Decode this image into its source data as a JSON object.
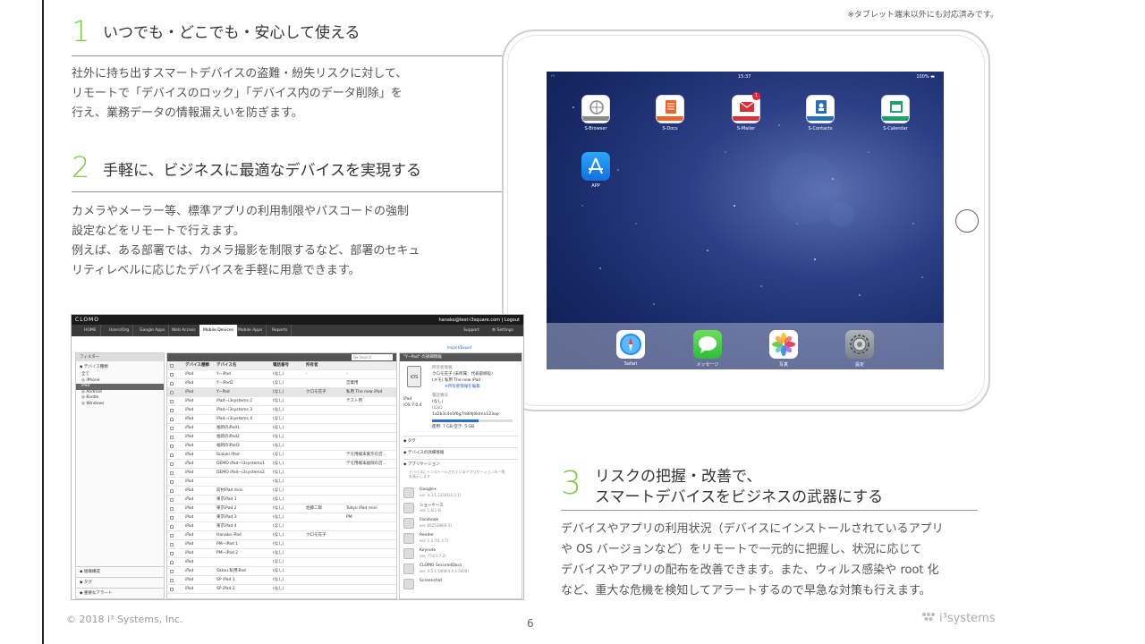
{
  "note": "※タブレット端末以外にも対応済みです。",
  "sections": [
    {
      "number": "1",
      "title": "いつでも・どこでも・安心して使える",
      "body": [
        "社外に持ち出すスマートデバイスの盗難・紛失リスクに対して、",
        "リモートで「デバイスのロック」「デバイス内のデータ削除」を",
        "行え、業務データの情報漏えいを防ぎます。"
      ]
    },
    {
      "number": "2",
      "title": "手軽に、ビジネスに最適なデバイスを実現する",
      "body": [
        "カメラやメーラー等、標準アプリの利用制限やパスコードの強制",
        "設定などをリモートで行えます。",
        "例えば、ある部署では、カメラ撮影を制限するなど、部署のセキュ",
        "リティレベルに応じたデバイスを手軽に用意できます。"
      ]
    },
    {
      "number": "3",
      "title_line1": "リスクの把握・改善で、",
      "title_line2": "スマートデバイスをビジネスの武器にする",
      "body": [
        "デバイスやアプリの利用状況（デバイスにインストールされているアプリ",
        "や OS バージョンなど）をリモートで一元的に把握し、状況に応じて",
        "デバイスやアプリの配布を改善できます。また、ウィルス感染や root 化",
        "など、重大な危機を検知してアラートするので早急な対策も行えます。"
      ]
    }
  ],
  "ipad": {
    "time": "15:37",
    "battery": "100%",
    "apps": [
      {
        "label": "S-Browser",
        "icon": "globe-icon",
        "color": "#8a8a8a",
        "band": "CLOMO"
      },
      {
        "label": "S-Docs",
        "icon": "document-icon",
        "color": "#e8662a",
        "band": "CLOMO"
      },
      {
        "label": "S-Mailer",
        "icon": "mail-icon",
        "color": "#d8303a",
        "band": "CLOMO",
        "badge": "1"
      },
      {
        "label": "S-Contacts",
        "icon": "contacts-icon",
        "color": "#2a6fb4",
        "band": "CLOMO"
      },
      {
        "label": "S-Calendar",
        "icon": "calendar-icon",
        "color": "#20a070",
        "band": "CLOMO"
      },
      {
        "label": "APP",
        "icon": "app-store-icon",
        "color": "#1e8ef0"
      }
    ],
    "dock": [
      {
        "label": "Safari",
        "icon": "safari-icon"
      },
      {
        "label": "メッセージ",
        "icon": "messages-icon"
      },
      {
        "label": "写真",
        "icon": "photos-icon"
      },
      {
        "label": "設定",
        "icon": "settings-icon"
      }
    ]
  },
  "console": {
    "logo": "CLOMO",
    "user": "hanako@test-i3square.com | Logout",
    "tabs": [
      "HOME",
      "Users/Org",
      "Google Apps",
      "Web Access",
      "Mobile Devices",
      "Mobile Apps",
      "Reports"
    ],
    "active_tab": "Mobile Devices",
    "support": "Support",
    "settings": "⚙ Settings",
    "import_export": "Import/Export",
    "filter": "フィルター",
    "device_type": "◆ デバイス種類",
    "filter_items": [
      "全て",
      "◎ iPhone",
      "iPad",
      "◎ Android",
      "◎ Kindle",
      "◎ Windows"
    ],
    "side_footer": [
      "◆ 組織構成",
      "◆ タグ",
      "◆ 重要なアラート"
    ],
    "search": "Q▾ Search",
    "columns": [
      "デバイス種類",
      "デバイス名",
      "電話番号",
      "所有者"
    ],
    "rows": [
      [
        "iPad",
        "Y−iPad",
        "(なし)",
        "-",
        "-"
      ],
      [
        "iPad",
        "Y−iPad2",
        "(なし)",
        "",
        "営業用"
      ],
      [
        "iPad",
        "Y−Pad",
        "(なし)",
        "クロモ花子",
        "私用 The new iPad"
      ],
      [
        "iPad",
        "iPad−i3systems 2",
        "(なし)",
        "",
        "テスト用"
      ],
      [
        "iPad",
        "iPad−i3systems 3",
        "(なし)",
        "",
        ""
      ],
      [
        "iPad",
        "iPad−i3systems 4",
        "(なし)",
        "",
        ""
      ],
      [
        "iPad",
        "福岡のiPad1",
        "(なし)",
        "",
        ""
      ],
      [
        "iPad",
        "福岡のiPad2",
        "(なし)",
        "",
        ""
      ],
      [
        "iPad",
        "福岡のiPad3",
        "(なし)",
        "",
        ""
      ],
      [
        "iPad",
        "Suzuki iPad",
        "(なし)",
        "",
        "デモ用端末東京の営..."
      ],
      [
        "iPad",
        "DEMO iPad−i3systems1",
        "(なし)",
        "",
        "デモ用端末福岡の営..."
      ],
      [
        "iPad",
        "DEMO iPad−i3systems2",
        "(なし)",
        "",
        ""
      ],
      [
        "iPad",
        "",
        "(なし)",
        "",
        ""
      ],
      [
        "iPad",
        "前村iPad mini",
        "(なし)",
        "",
        ""
      ],
      [
        "iPad",
        "東京iPad 1",
        "(なし)",
        "",
        ""
      ],
      [
        "iPad",
        "東京iPad 2",
        "(なし)",
        "佐藤二郎",
        "Tokyo iPad mini"
      ],
      [
        "iPad",
        "東京iPad 3",
        "(なし)",
        "",
        "PM"
      ],
      [
        "iPad",
        "東京iPad 4",
        "(なし)",
        "",
        ""
      ],
      [
        "iPad",
        "Hanako iPad",
        "(なし)",
        "クロモ花子",
        ""
      ],
      [
        "iPad",
        "PM−iPad 1",
        "(なし)",
        "",
        ""
      ],
      [
        "iPad",
        "PM−iPad 2",
        "(なし)",
        "",
        ""
      ],
      [
        "iPad",
        "",
        "(なし)",
        "",
        ""
      ],
      [
        "iPad",
        "Satou 私用iPad",
        "(なし)",
        "",
        ""
      ],
      [
        "iPad",
        "SP iPad 1",
        "(なし)",
        "",
        ""
      ],
      [
        "iPad",
        "SP iPad 2",
        "(なし)",
        "",
        ""
      ]
    ],
    "detail": {
      "header": "\"Y−Pad\" の詳細情報",
      "owner_label": "所有者情報",
      "owner": "クロモ花子 (未所属：代表取締役)",
      "usage": "(メモ)  私用 The new iPad",
      "edit": "※所有者情報を編集",
      "ios": "iOS",
      "device": "iPad",
      "os": "iOS 7.0.4",
      "phone_label": "電話番号",
      "phone": "(なし)",
      "udid_label": "UDID",
      "udid": "1a2b3c4e5f6g7h8i9j0klmn123op",
      "capacity": "使用: 7 GB   空き: 5 GB",
      "sections": [
        "◆ タグ",
        "◆ デバイスの詳細情報",
        "◆ アプリケーション"
      ],
      "apps_note": "デバイスにインストールされているアプリケーションの一覧を表示します",
      "apps": [
        {
          "name": "Google+",
          "ver": "ver. 4.3.1.23341(4.3.1)"
        },
        {
          "name": "ショーケース",
          "ver": "ver. 1.6(1.6)"
        },
        {
          "name": "Facebook",
          "ver": "ver. 6625286(6.5)"
        },
        {
          "name": "Reeder",
          "ver": "ver. 1.3.7(1.3.7)"
        },
        {
          "name": "Keynote",
          "ver": "ver. 751(1.7.2)"
        },
        {
          "name": "CLOMO SecuredDocs",
          "ver": "ver. 4.5.1.5400(4.0.1.5400)"
        },
        {
          "name": "Screenshot",
          "ver": ""
        }
      ]
    }
  },
  "footer": {
    "copyright": "© 2018 i³ Systems, Inc.",
    "page": "6",
    "brand": "i³systems"
  }
}
